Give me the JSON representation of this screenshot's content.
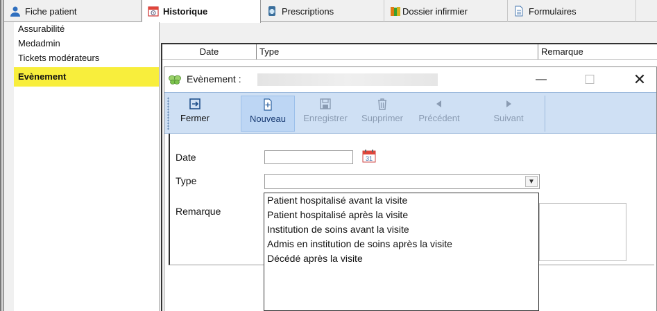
{
  "tabs": [
    {
      "label": "Fiche patient",
      "icon": "person-icon"
    },
    {
      "label": "Historique",
      "icon": "calendar-icon",
      "active": true
    },
    {
      "label": "Prescriptions",
      "icon": "prescription-icon"
    },
    {
      "label": "Dossier infirmier",
      "icon": "books-icon"
    },
    {
      "label": "Formulaires",
      "icon": "document-icon"
    }
  ],
  "sidebar": {
    "items": [
      {
        "label": "Assurabilité"
      },
      {
        "label": "Medadmin"
      },
      {
        "label": "Tickets modérateurs"
      },
      {
        "label": "Evènement",
        "active": true
      }
    ]
  },
  "grid": {
    "columns": [
      "Date",
      "Type",
      "Remarque"
    ]
  },
  "dialog": {
    "title": "Evènement :",
    "toolbar": {
      "fermer": "Fermer",
      "nouveau": "Nouveau",
      "enregistrer": "Enregistrer",
      "supprimer": "Supprimer",
      "precedent": "Précédent",
      "suivant": "Suivant"
    },
    "form": {
      "date_label": "Date",
      "date_value": "",
      "type_label": "Type",
      "type_value": "",
      "remarque_label": "Remarque"
    },
    "type_options": [
      "Patient hospitalisé avant la visite",
      "Patient hospitalisé après la visite",
      "Institution de soins avant la visite",
      "Admis en institution de soins après la visite",
      "Décédé après la visite"
    ]
  },
  "colors": {
    "toolbar_bg": "#cfe0f4",
    "active_side": "#f8ee3c"
  }
}
